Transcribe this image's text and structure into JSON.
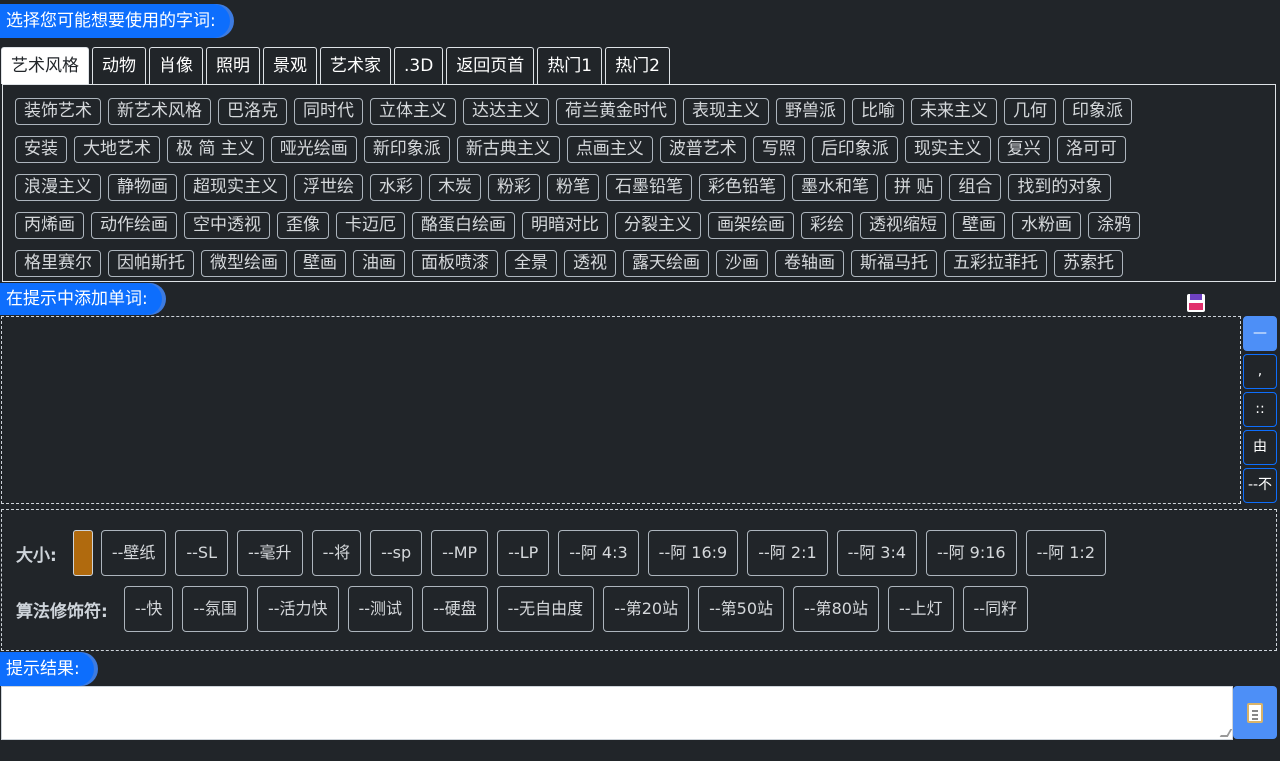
{
  "labels": {
    "select_words": "选择您可能想要使用的字词:",
    "add_words": "在提示中添加单词:",
    "result": "提示结果:"
  },
  "tabs": [
    {
      "label": "艺术风格",
      "active": true
    },
    {
      "label": "动物"
    },
    {
      "label": "肖像"
    },
    {
      "label": "照明"
    },
    {
      "label": "景观"
    },
    {
      "label": "艺术家"
    },
    {
      "label": ".3D"
    },
    {
      "label": "返回页首"
    },
    {
      "label": "热门1"
    },
    {
      "label": "热门2"
    }
  ],
  "words": [
    [
      "装饰艺术",
      "新艺术风格",
      "巴洛克",
      "同时代",
      "立体主义",
      "达达主义",
      "荷兰黄金时代",
      "表现主义",
      "野兽派",
      "比喻",
      "未来主义",
      "几何",
      "印象派"
    ],
    [
      "安装",
      "大地艺术",
      "极 简 主义",
      "哑光绘画",
      "新印象派",
      "新古典主义",
      "点画主义",
      "波普艺术",
      "写照",
      "后印象派",
      "现实主义",
      "复兴",
      "洛可可"
    ],
    [
      "浪漫主义",
      "静物画",
      "超现实主义",
      "浮世绘",
      "水彩",
      "木炭",
      "粉彩",
      "粉笔",
      "石墨铅笔",
      "彩色铅笔",
      "墨水和笔",
      "拼 贴",
      "组合",
      "找到的对象"
    ],
    [
      "丙烯画",
      "动作绘画",
      "空中透视",
      "歪像",
      "卡迈厄",
      "酪蛋白绘画",
      "明暗对比",
      "分裂主义",
      "画架绘画",
      "彩绘",
      "透视缩短",
      "壁画",
      "水粉画",
      "涂鸦"
    ],
    [
      "格里赛尔",
      "因帕斯托",
      "微型绘画",
      "壁画",
      "油画",
      "面板喷漆",
      "全景",
      "透视",
      "露天绘画",
      "沙画",
      "卷轴画",
      "斯福马托",
      "五彩拉菲托",
      "苏索托"
    ]
  ],
  "side_buttons": [
    "—",
    ",",
    "::",
    "由",
    "--不"
  ],
  "size_label": "大小:",
  "size_color": "#b06a0e",
  "size_options": [
    "--壁纸",
    "--SL",
    "--毫升",
    "--将",
    "--sp",
    "--MP",
    "--LP",
    "--阿 4:3",
    "--阿 16:9",
    "--阿 2:1",
    "--阿 3:4",
    "--阿 9:16",
    "--阿 1:2"
  ],
  "algo_label": "算法修饰符:",
  "algo_options": [
    "--快",
    "--氛围",
    "--活力快",
    "--测试",
    "--硬盘",
    "--无自由度",
    "--第20站",
    "--第50站",
    "--第80站",
    "--上灯",
    "--同籽"
  ],
  "icons": {
    "save": "floppy-disk-icon",
    "copy": "clipboard-icon"
  }
}
